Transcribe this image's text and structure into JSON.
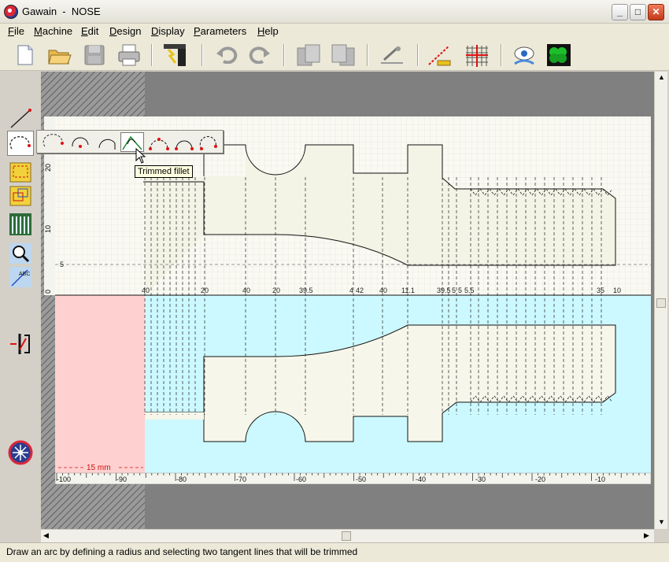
{
  "window": {
    "app": "Gawain",
    "separator": " - ",
    "document": "NOSE",
    "title_full": "Gawain  -  NOSE"
  },
  "window_controls": {
    "minimize": "_",
    "maximize": "□",
    "close": "✕"
  },
  "menu": [
    "File",
    "Machine",
    "Edit",
    "Design",
    "Display",
    "Parameters",
    "Help"
  ],
  "toolbar": {
    "icons": [
      "new-document",
      "open-folder",
      "save-disk",
      "print",
      "machine-tool",
      "undo",
      "redo",
      "copy-left",
      "copy-right",
      "measure-tool",
      "dimension-line",
      "grid",
      "view-eye",
      "chain-3d"
    ]
  },
  "left_tools": [
    "line-tool",
    "arc-tool",
    "rect-select",
    "transform",
    "thread-tool",
    "zoom",
    "dimension-text",
    "tool-path",
    "help-star"
  ],
  "arc_flyout": {
    "icons": [
      "arc-3pt",
      "arc-center",
      "arc-tangent",
      "trimmed-fillet",
      "arc-points-a",
      "arc-points-b",
      "arc-points-c"
    ],
    "tooltip": "Trimmed fillet"
  },
  "drawing": {
    "y_ticks": [
      "20",
      "10",
      "0"
    ],
    "y_dash_label": "5",
    "dimension_labels": [
      "40",
      "20",
      "40",
      "20",
      "39.5",
      "4",
      "42",
      "40",
      "11.1",
      "39.5",
      "5",
      "5",
      "5.5",
      "35",
      "10"
    ],
    "x_ticks": [
      "-100",
      "-90",
      "-80",
      "-70",
      "-60",
      "-50",
      "-40",
      "-30",
      "-20",
      "-10"
    ],
    "stock_label": "15 mm"
  },
  "colors": {
    "workspace": "#808080",
    "paper": "#fafaf3",
    "grid": "#dcdcd6",
    "part": "#f3f3e6",
    "stock": "#ccf9ff",
    "holder": "#ffd0d0"
  },
  "status": "Draw an arc by defining a radius and selecting two tangent lines that will be trimmed"
}
